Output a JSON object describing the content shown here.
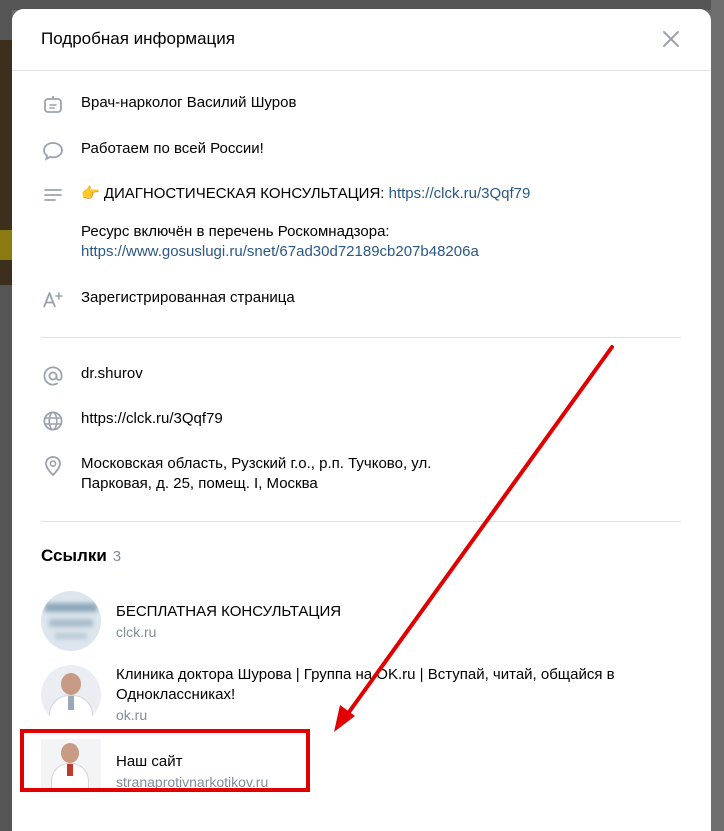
{
  "modal": {
    "title": "Подробная информация"
  },
  "info": {
    "name": "Врач-нарколог Василий Шуров",
    "status": "Работаем по всей России!",
    "desc_emoji": "👉",
    "desc_text": "ДИАГНОСТИЧЕСКАЯ КОНСУЛЬТАЦИЯ: ",
    "desc_link": "https://clck.ru/3Qqf79",
    "registry_text": "Ресурс включён в перечень Роскомнадзора:",
    "registry_link": "https://www.gosuslugi.ru/snet/67ad30d72189cb207b48206a",
    "registered_label": "Зарегистрированная страница"
  },
  "contacts": {
    "nickname": "dr.shurov",
    "website": "https://clck.ru/3Qqf79",
    "address_line1": "Московская область, Рузский г.о., р.п. Тучково, ул.",
    "address_line2": "Парковая, д. 25, помещ. I, Москва"
  },
  "links": {
    "title": "Ссылки",
    "count": "3",
    "items": [
      {
        "title": "БЕСПЛАТНАЯ КОНСУЛЬТАЦИЯ",
        "domain": "clck.ru"
      },
      {
        "title_line1": "Клиника доктора Шурова | Группа на OK.ru | Вступай, читай, общайся в",
        "title_line2": "Одноклассниках!",
        "domain": "ok.ru"
      },
      {
        "title": "Наш сайт",
        "domain": "stranaprotivnarkotikov.ru"
      }
    ]
  },
  "colors": {
    "link": "#2a5885",
    "muted": "#818c99",
    "annotation": "#e00000"
  }
}
